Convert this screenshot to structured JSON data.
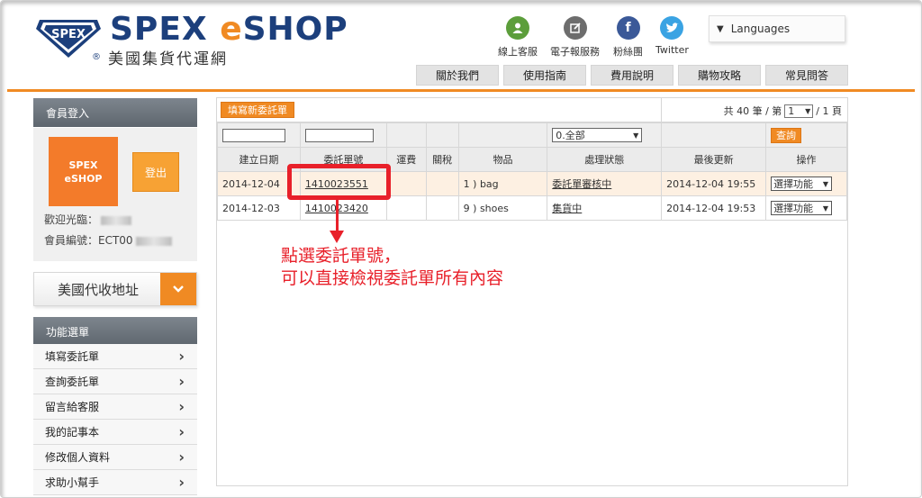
{
  "brand": {
    "name_main": "SPEX ",
    "name_e": "e",
    "name_shop": "SHOP",
    "registered": "®",
    "subtitle": "美國集貨代運網",
    "badge_text": "SPEX",
    "color_blue": "#1c3f7c",
    "color_orange": "#f08a23"
  },
  "social": [
    {
      "label": "線上客服",
      "icon": "person-icon",
      "color": "#5c9e3b"
    },
    {
      "label": "電子報服務",
      "icon": "edit-icon",
      "color": "#6d6d6d"
    },
    {
      "label": "粉絲團",
      "icon": "facebook-icon",
      "color": "#3b5998"
    },
    {
      "label": "Twitter",
      "icon": "twitter-icon",
      "color": "#3aa3e3"
    }
  ],
  "languages_label": "Languages",
  "nav": [
    "關於我們",
    "使用指南",
    "費用說明",
    "購物攻略",
    "常見問答"
  ],
  "sidebar": {
    "login_title": "會員登入",
    "tile_line1": "SPEX",
    "tile_line2": "eSHOP",
    "logout": "登出",
    "welcome": "歡迎光臨：",
    "member_no": "會員編號：ECT00",
    "address_button": "美國代收地址",
    "menu_title": "功能選單",
    "menu_items": [
      "填寫委託單",
      "查詢委託單",
      "留言給客服",
      "我的記事本",
      "修改個人資料",
      "求助小幫手"
    ]
  },
  "toolbar": {
    "new_order": "填寫新委託單",
    "pager_prefix": "共 40 筆 / 第",
    "page_value": "1",
    "pager_suffix": "/ 1 頁"
  },
  "filter": {
    "status_value": "0.全部",
    "query": "查詢"
  },
  "table": {
    "headers": [
      "建立日期",
      "委託單號",
      "運費",
      "關稅",
      "物品",
      "處理狀態",
      "最後更新",
      "操作"
    ],
    "rows": [
      {
        "date": "2014-12-04",
        "order_no": "1410023551",
        "freight": "",
        "duty": "",
        "items": "1 ) bag",
        "status": "委託單審核中",
        "updated": "2014-12-04 19:55",
        "action": "選擇功能"
      },
      {
        "date": "2014-12-03",
        "order_no": "1410023420",
        "freight": "",
        "duty": "",
        "items": "9 ) shoes",
        "status": "集貨中",
        "updated": "2014-12-04 19:53",
        "action": "選擇功能"
      }
    ]
  },
  "annotation": {
    "line1": "點選委託單號，",
    "line2": "可以直接檢視委託單所有內容",
    "color": "#e8202a"
  }
}
